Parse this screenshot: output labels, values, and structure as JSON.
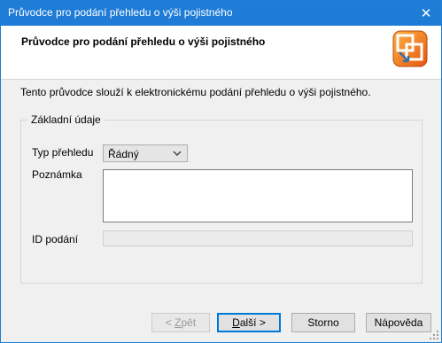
{
  "window": {
    "title": "Průvodce pro  podání přehledu o výši pojistného",
    "close_glyph": "✕"
  },
  "header": {
    "title": "Průvodce pro  podání přehledu o výši pojistného",
    "logo_icon": "wizard-logo-icon"
  },
  "intro_text": "Tento průvodce slouží k elektronickému podání přehledu o výši pojistného.",
  "group": {
    "legend": "Základní údaje",
    "fields": {
      "typ_label": "Typ přehledu",
      "typ_value": "Řádný",
      "poznamka_label": "Poznámka",
      "poznamka_value": "",
      "id_label": "ID podání",
      "id_value": ""
    }
  },
  "buttons": {
    "back_prefix": "< ",
    "back_key": "Z",
    "back_rest": "pět",
    "next_key": "D",
    "next_rest": "alší >",
    "cancel": "Storno",
    "help": "Nápověda"
  },
  "colors": {
    "titlebar": "#1e7cd6",
    "accent": "#0078d7",
    "logo_orange": "#f07a1e"
  }
}
